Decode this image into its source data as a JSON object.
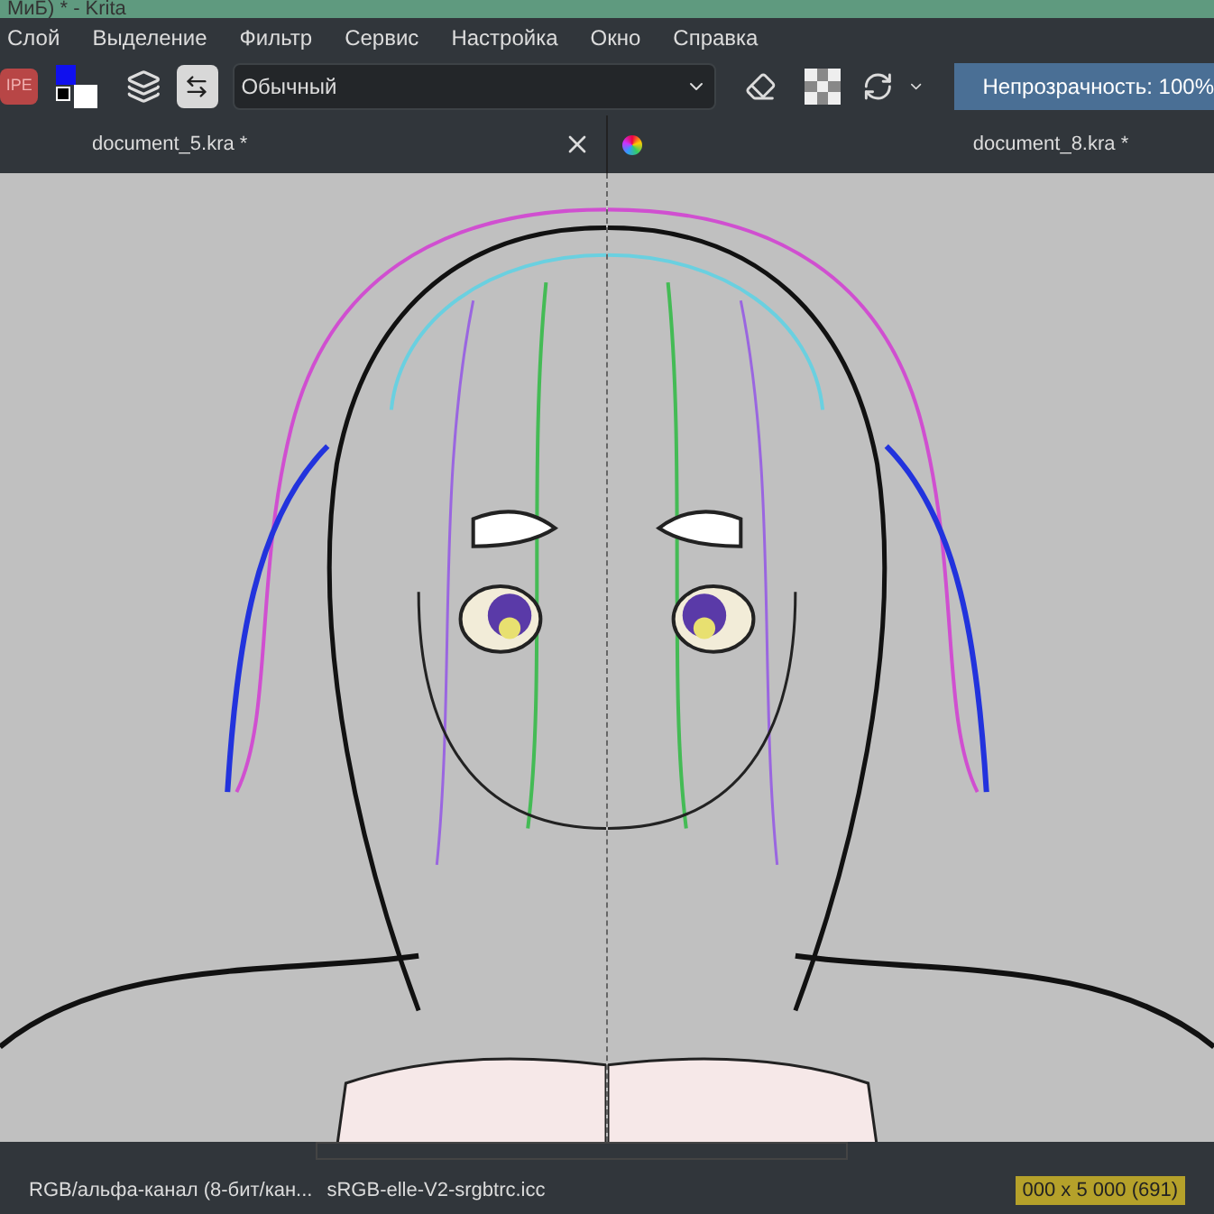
{
  "window": {
    "title": "МиБ) * - Krita"
  },
  "menu": [
    "Слой",
    "Выделение",
    "Фильтр",
    "Сервис",
    "Настройка",
    "Окно",
    "Справка"
  ],
  "toolbar": {
    "preset": "IPE",
    "blend_mode": "Обычный",
    "opacity": {
      "label": "Непрозрачность: 100%",
      "level": 1
    }
  },
  "documents": [
    {
      "name": "document_5.kra *",
      "closable": true,
      "icon": false
    },
    {
      "name": "document_8.kra *",
      "closable": false,
      "icon": true
    }
  ],
  "status_bar": {
    "color_space": "RGB/альфа-канал (8-бит/кан...",
    "profile": "sRGB-elle-V2-srgbtrc.icc",
    "size": "000 x 5 000 (691)"
  }
}
